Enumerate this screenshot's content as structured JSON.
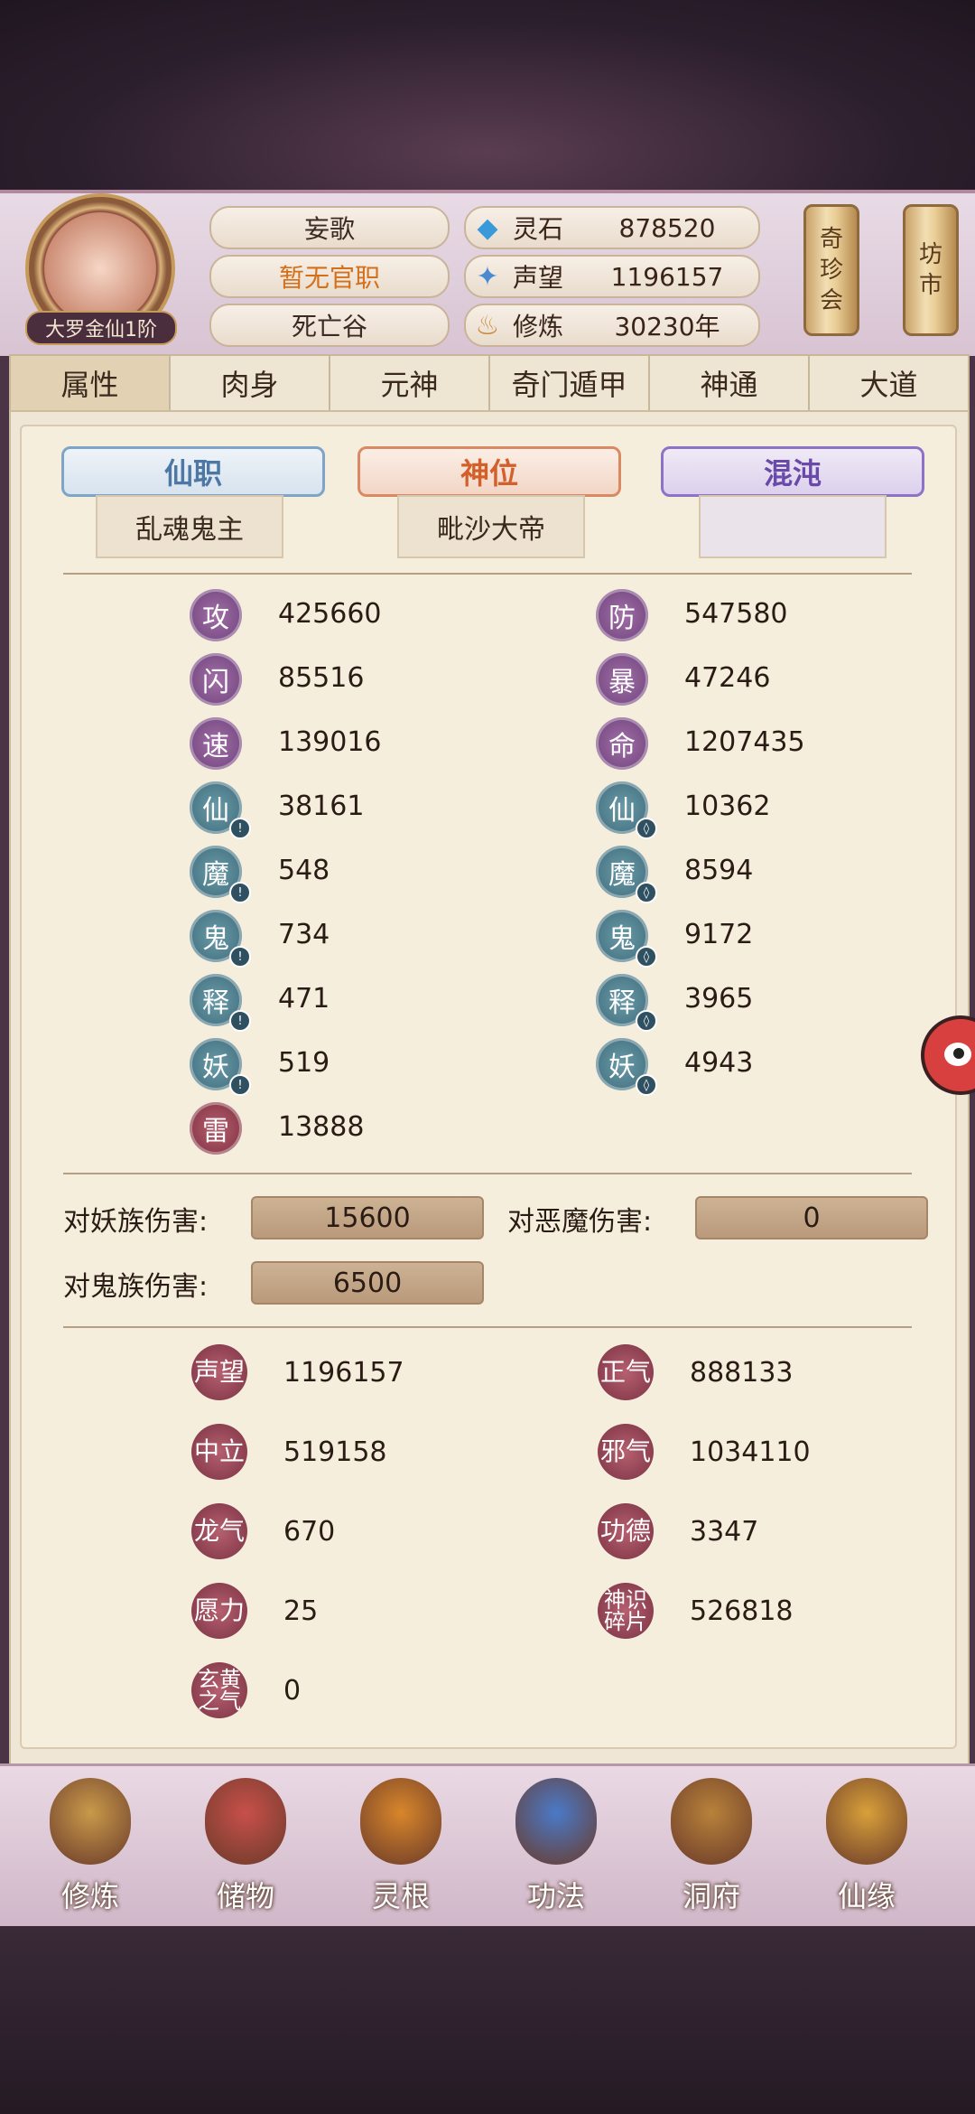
{
  "header": {
    "rank": "大罗金仙1阶",
    "name": "妄歌",
    "official": "暂无官职",
    "location": "死亡谷",
    "resources": [
      {
        "icon": "spirit-stone-icon",
        "label": "灵石",
        "value": "878520"
      },
      {
        "icon": "reputation-icon",
        "label": "声望",
        "value": "1196157"
      },
      {
        "icon": "cultivation-icon",
        "label": "修炼",
        "value": "30230年"
      }
    ],
    "scroll_buttons": [
      {
        "label": [
          "奇",
          "珍",
          "会"
        ]
      },
      {
        "label": [
          "坊",
          "市"
        ]
      }
    ]
  },
  "tabs": [
    "属性",
    "肉身",
    "元神",
    "奇门遁甲",
    "神通",
    "大道"
  ],
  "active_tab": 0,
  "titles": {
    "xianzhi": {
      "label": "仙职",
      "value": "乱魂鬼主"
    },
    "shenwei": {
      "label": "神位",
      "value": "毗沙大帝"
    },
    "hundun": {
      "label": "混沌",
      "value": ""
    }
  },
  "stats_left": [
    {
      "icon": "攻",
      "value": "425660",
      "color": "purple",
      "badge": ""
    },
    {
      "icon": "闪",
      "value": "85516",
      "color": "purple",
      "badge": ""
    },
    {
      "icon": "速",
      "value": "139016",
      "color": "purple",
      "badge": ""
    },
    {
      "icon": "仙",
      "value": "38161",
      "color": "teal",
      "badge": "attack"
    },
    {
      "icon": "魔",
      "value": "548",
      "color": "teal",
      "badge": "attack"
    },
    {
      "icon": "鬼",
      "value": "734",
      "color": "teal",
      "badge": "attack"
    },
    {
      "icon": "释",
      "value": "471",
      "color": "teal",
      "badge": "attack"
    },
    {
      "icon": "妖",
      "value": "519",
      "color": "teal",
      "badge": "attack"
    },
    {
      "icon": "雷",
      "value": "13888",
      "color": "red",
      "badge": ""
    }
  ],
  "stats_right": [
    {
      "icon": "防",
      "value": "547580",
      "color": "purple",
      "badge": ""
    },
    {
      "icon": "暴",
      "value": "47246",
      "color": "purple",
      "badge": ""
    },
    {
      "icon": "命",
      "value": "1207435",
      "color": "purple",
      "badge": ""
    },
    {
      "icon": "仙",
      "value": "10362",
      "color": "teal",
      "badge": "defense"
    },
    {
      "icon": "魔",
      "value": "8594",
      "color": "teal",
      "badge": "defense"
    },
    {
      "icon": "鬼",
      "value": "9172",
      "color": "teal",
      "badge": "defense"
    },
    {
      "icon": "释",
      "value": "3965",
      "color": "teal",
      "badge": "defense"
    },
    {
      "icon": "妖",
      "value": "4943",
      "color": "teal",
      "badge": "defense"
    }
  ],
  "damage": {
    "yao_label": "对妖族伤害:",
    "yao_value": "15600",
    "emo_label": "对恶魔伤害:",
    "emo_value": "0",
    "gui_label": "对鬼族伤害:",
    "gui_value": "6500"
  },
  "misc_left": [
    {
      "icon": "声望",
      "value": "1196157"
    },
    {
      "icon": "中立",
      "value": "519158"
    },
    {
      "icon": "龙气",
      "value": "670"
    },
    {
      "icon": "愿力",
      "value": "25"
    },
    {
      "icon": "玄黄之气",
      "value": "0"
    }
  ],
  "misc_right": [
    {
      "icon": "正气",
      "value": "888133"
    },
    {
      "icon": "邪气",
      "value": "1034110"
    },
    {
      "icon": "功德",
      "value": "3347"
    },
    {
      "icon": "神识碎片",
      "value": "526818"
    }
  ],
  "nav": [
    {
      "label": "修炼",
      "icon": "cultivate-icon"
    },
    {
      "label": "储物",
      "icon": "storage-bag-icon"
    },
    {
      "label": "灵根",
      "icon": "spirit-root-icon"
    },
    {
      "label": "功法",
      "icon": "technique-book-icon"
    },
    {
      "label": "洞府",
      "icon": "cave-house-icon"
    },
    {
      "label": "仙缘",
      "icon": "immortal-fate-icon"
    }
  ],
  "colors": {
    "accent_orange": "#d46f1a",
    "stat_purple": "#6b3f78",
    "stat_teal": "#3d6a7a",
    "stat_red": "#7c3040"
  }
}
